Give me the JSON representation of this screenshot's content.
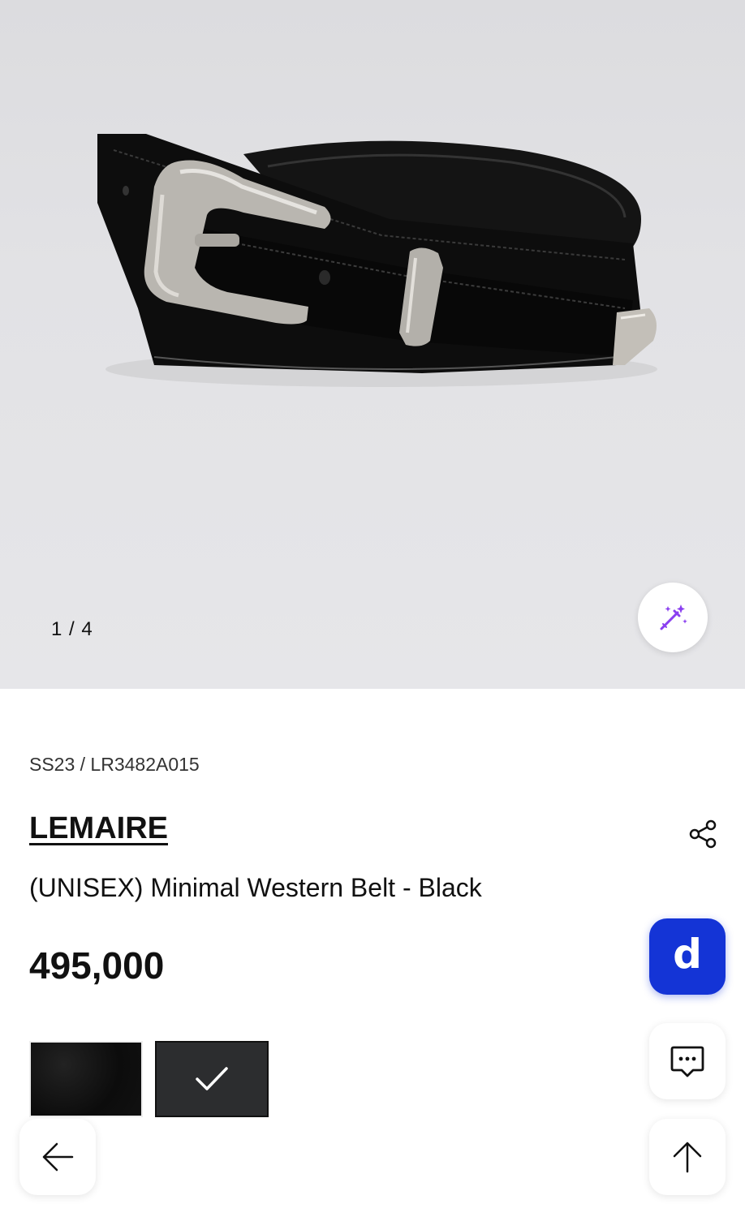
{
  "gallery": {
    "pager": "1 / 4"
  },
  "product": {
    "season_code": "SS23 / LR3482A015",
    "brand": "LEMAIRE",
    "name": "(UNISEX) Minimal Western Belt - Black",
    "price": "495,000"
  },
  "floating": {
    "app_badge": "d"
  },
  "icons": {
    "magic": "magic-wand-icon",
    "share": "share-icon",
    "chat": "chat-icon",
    "scroll_top": "arrow-up-icon",
    "back": "arrow-left-icon",
    "selected": "check-icon"
  },
  "colors": {
    "brand_accent": "#1434d6",
    "magic_icon": "#8a3ff0"
  }
}
